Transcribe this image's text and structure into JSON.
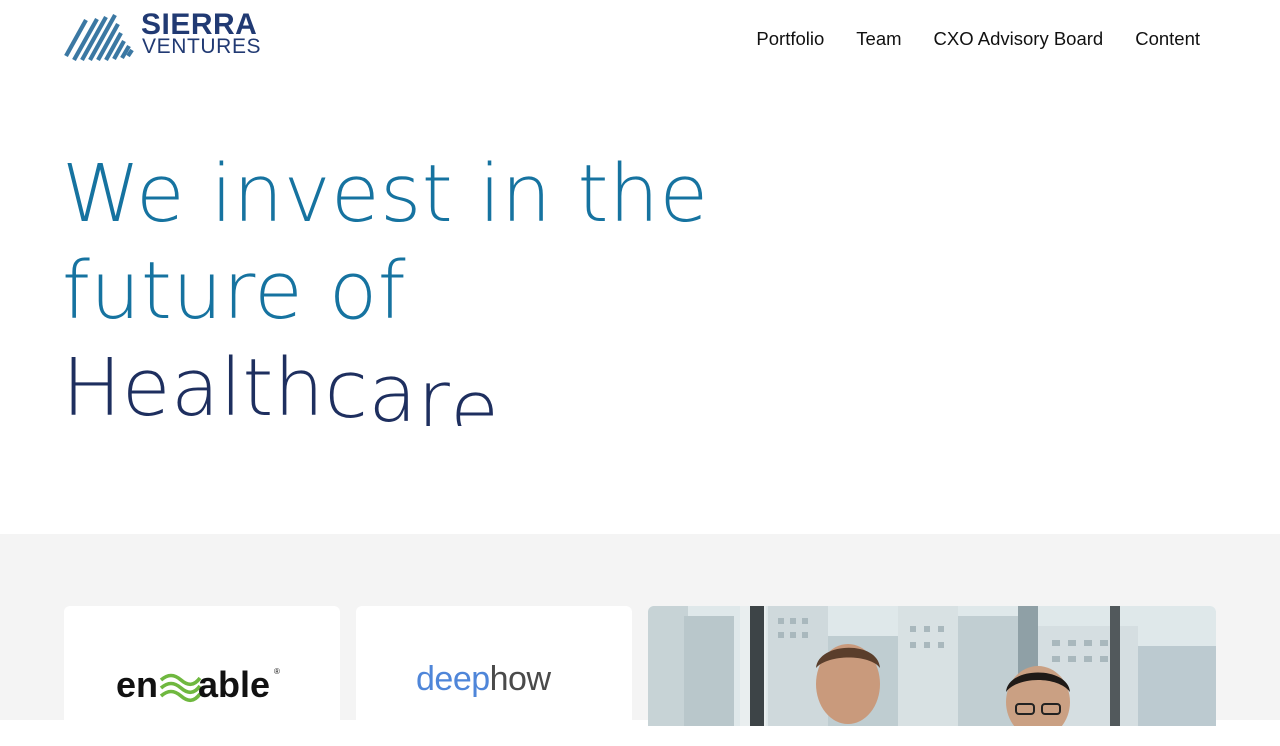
{
  "header": {
    "logo": {
      "line1": "SIERRA",
      "line2": "VENTURES"
    },
    "nav": [
      {
        "label": "Portfolio"
      },
      {
        "label": "Team"
      },
      {
        "label": "CXO Advisory Board"
      },
      {
        "label": "Content"
      }
    ]
  },
  "hero": {
    "line1": "We invest in the",
    "line2": "future of",
    "rotating_word": [
      "H",
      "e",
      "a",
      "l",
      "t",
      "h",
      "c",
      "a",
      "r",
      "e"
    ]
  },
  "featured": {
    "cards": [
      {
        "logo_text_1": "en",
        "logo_text_2": "able",
        "logo_mark": "®"
      },
      {
        "logo_text_1": "deep",
        "logo_text_2": "how"
      }
    ],
    "photo": {
      "subject": "two-people-photo"
    }
  },
  "colors": {
    "brand_navy": "#213a73",
    "hero_teal": "#1673a0",
    "hero_navy": "#1e2f5f",
    "section_bg": "#f4f4f4"
  }
}
